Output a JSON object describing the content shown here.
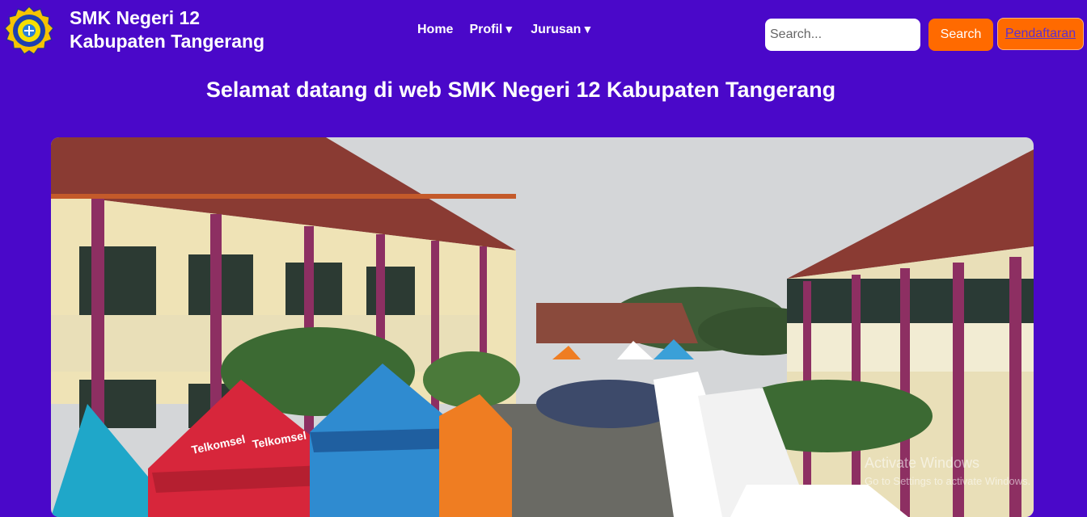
{
  "header": {
    "school_name_line1": "SMK Negeri 12",
    "school_name_line2": "Kabupaten Tangerang",
    "logo_icon": "school-emblem-icon"
  },
  "nav": {
    "items": [
      {
        "label": "Home"
      },
      {
        "label": "Profil",
        "caret": "▼"
      },
      {
        "label": "Jurusan",
        "caret": "▼"
      }
    ]
  },
  "search": {
    "placeholder": "Search...",
    "value": "",
    "button_label": "Search"
  },
  "register_label": "Pendaftaran",
  "welcome_text": "Selamat datang di web SMK Negeri 12 Kabupaten Tangerang",
  "hero": {
    "tent_brand_text": "Telkomsel"
  },
  "watermark": {
    "title": "Activate Windows",
    "subtitle": "Go to Settings to activate Windows."
  },
  "colors": {
    "background": "#4a08c9",
    "accent_orange": "#ff6a00",
    "text_white": "#ffffff"
  }
}
